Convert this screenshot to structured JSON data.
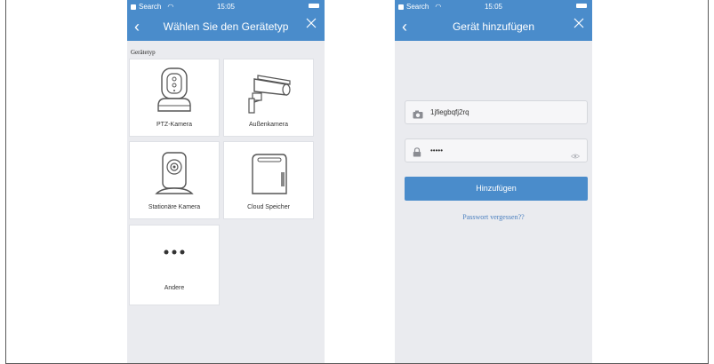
{
  "colors": {
    "accent": "#4a8ccb",
    "background": "#eaebef",
    "tile": "#ffffff"
  },
  "screen_select": {
    "status": {
      "carrier": "Search",
      "time": "15:05"
    },
    "nav": {
      "back_icon": "chevron-left-icon",
      "title": "Wählen Sie den Gerätetyp",
      "close_icon": "close-icon"
    },
    "section_label": "Gerätetyp",
    "device_types": [
      {
        "label": "PTZ-Kamera",
        "icon": "ptz-camera-icon"
      },
      {
        "label": "Außenkamera",
        "icon": "outdoor-camera-icon"
      },
      {
        "label": "Stationäre Kamera",
        "icon": "fixed-camera-icon"
      },
      {
        "label": "Cloud Speicher",
        "icon": "cloud-storage-icon"
      },
      {
        "label": "Andere",
        "icon": "more-icon"
      }
    ]
  },
  "screen_add": {
    "status": {
      "carrier": "Search",
      "time": "15:05"
    },
    "nav": {
      "back_icon": "chevron-left-icon",
      "title": "Gerät hinzufügen",
      "close_icon": "close-icon"
    },
    "device_id": {
      "value": "1jfiegbqfj2rq",
      "icon": "camera-icon"
    },
    "password": {
      "value": "•••••",
      "icon": "lock-icon",
      "toggle_icon": "eye-icon"
    },
    "add_button": "Hinzufügen",
    "forgot_link": "Passwort vergessen??"
  }
}
